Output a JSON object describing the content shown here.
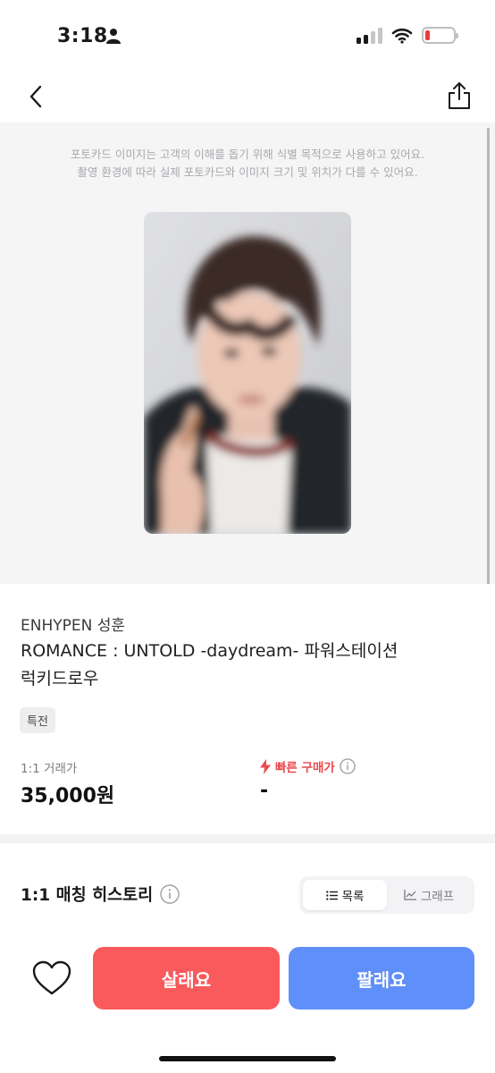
{
  "status_bar": {
    "time": "3:18",
    "battery_level": 0.15,
    "battery_color": "#ef3b3b"
  },
  "nav": {
    "back_icon": "chevron-left-icon",
    "share_icon": "share-icon"
  },
  "image_area": {
    "notice_line1": "포토카드 이미지는 고객의 이해를 돕기 위해 식별 목적으로 사용하고 있어요.",
    "notice_line2": "촬영 환경에 따라 실제 포토카드와 이미지 크기 및 위치가 다를 수 있어요."
  },
  "product": {
    "artist": "ENHYPEN 성훈",
    "title_line1": "ROMANCE : UNTOLD -daydream- 파워스테이션",
    "title_line2": "럭키드로우",
    "tag": "특전"
  },
  "prices": {
    "one_to_one_label": "1:1 거래가",
    "one_to_one_value": "35,000원",
    "fast_buy_label": "빠른 구매가",
    "fast_buy_value": "-",
    "fast_buy_color": "#e94a4f"
  },
  "history": {
    "title": "1:1 매칭 히스토리",
    "tabs": [
      {
        "label": "목록",
        "icon": "list-icon",
        "active": true
      },
      {
        "label": "그래프",
        "icon": "chart-icon",
        "active": false
      }
    ]
  },
  "actions": {
    "buy_label": "살래요",
    "sell_label": "팔래요",
    "buy_color": "#f95a5c",
    "sell_color": "#5f8ff8"
  }
}
